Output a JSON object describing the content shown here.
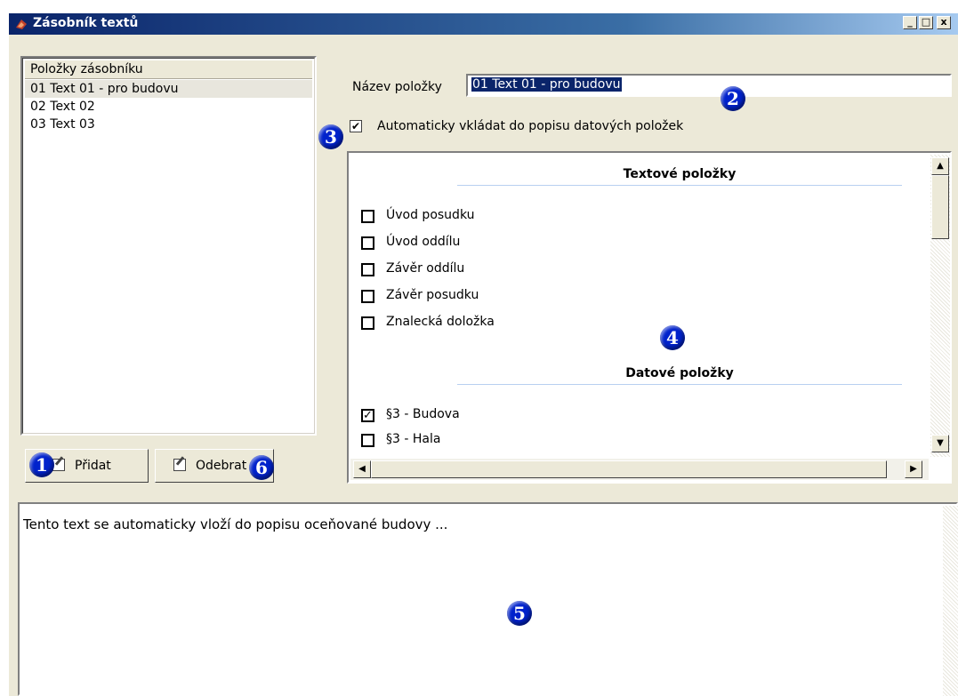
{
  "window": {
    "title": "Zásobník textů",
    "controls": {
      "minimize": "_",
      "maximize": "□",
      "close": "x"
    }
  },
  "list": {
    "header": "Položky zásobníku",
    "items": [
      "01 Text 01 - pro budovu",
      "02 Text 02",
      "03 Text 03"
    ],
    "selected_index": 0
  },
  "buttons": {
    "add": "Přidat",
    "remove": "Odebrat"
  },
  "name_field": {
    "label": "Název položky",
    "value": "01 Text 01 - pro budovu"
  },
  "auto_insert": {
    "label": "Automaticky vkládat do popisu datových položek",
    "checked": true
  },
  "panel": {
    "text_section_title": "Textové položky",
    "text_items": [
      {
        "label": "Úvod posudku",
        "checked": false
      },
      {
        "label": "Úvod oddílu",
        "checked": false
      },
      {
        "label": "Závěr oddílu",
        "checked": false
      },
      {
        "label": "Závěr posudku",
        "checked": false
      },
      {
        "label": "Znalecká doložka",
        "checked": false
      }
    ],
    "data_section_title": "Datové položky",
    "data_items": [
      {
        "label": "§3 - Budova",
        "checked": true
      },
      {
        "label": "§3 - Hala",
        "checked": false
      }
    ]
  },
  "text_area": {
    "value": "Tento text se automaticky vloží do popisu oceňované budovy ..."
  },
  "callouts": [
    "1",
    "2",
    "3",
    "4",
    "5",
    "6"
  ],
  "colors": {
    "title_bar": "#0a246a",
    "window_bg": "#ece9d8",
    "selection": "#0a246a",
    "callout": "#0022cc"
  }
}
